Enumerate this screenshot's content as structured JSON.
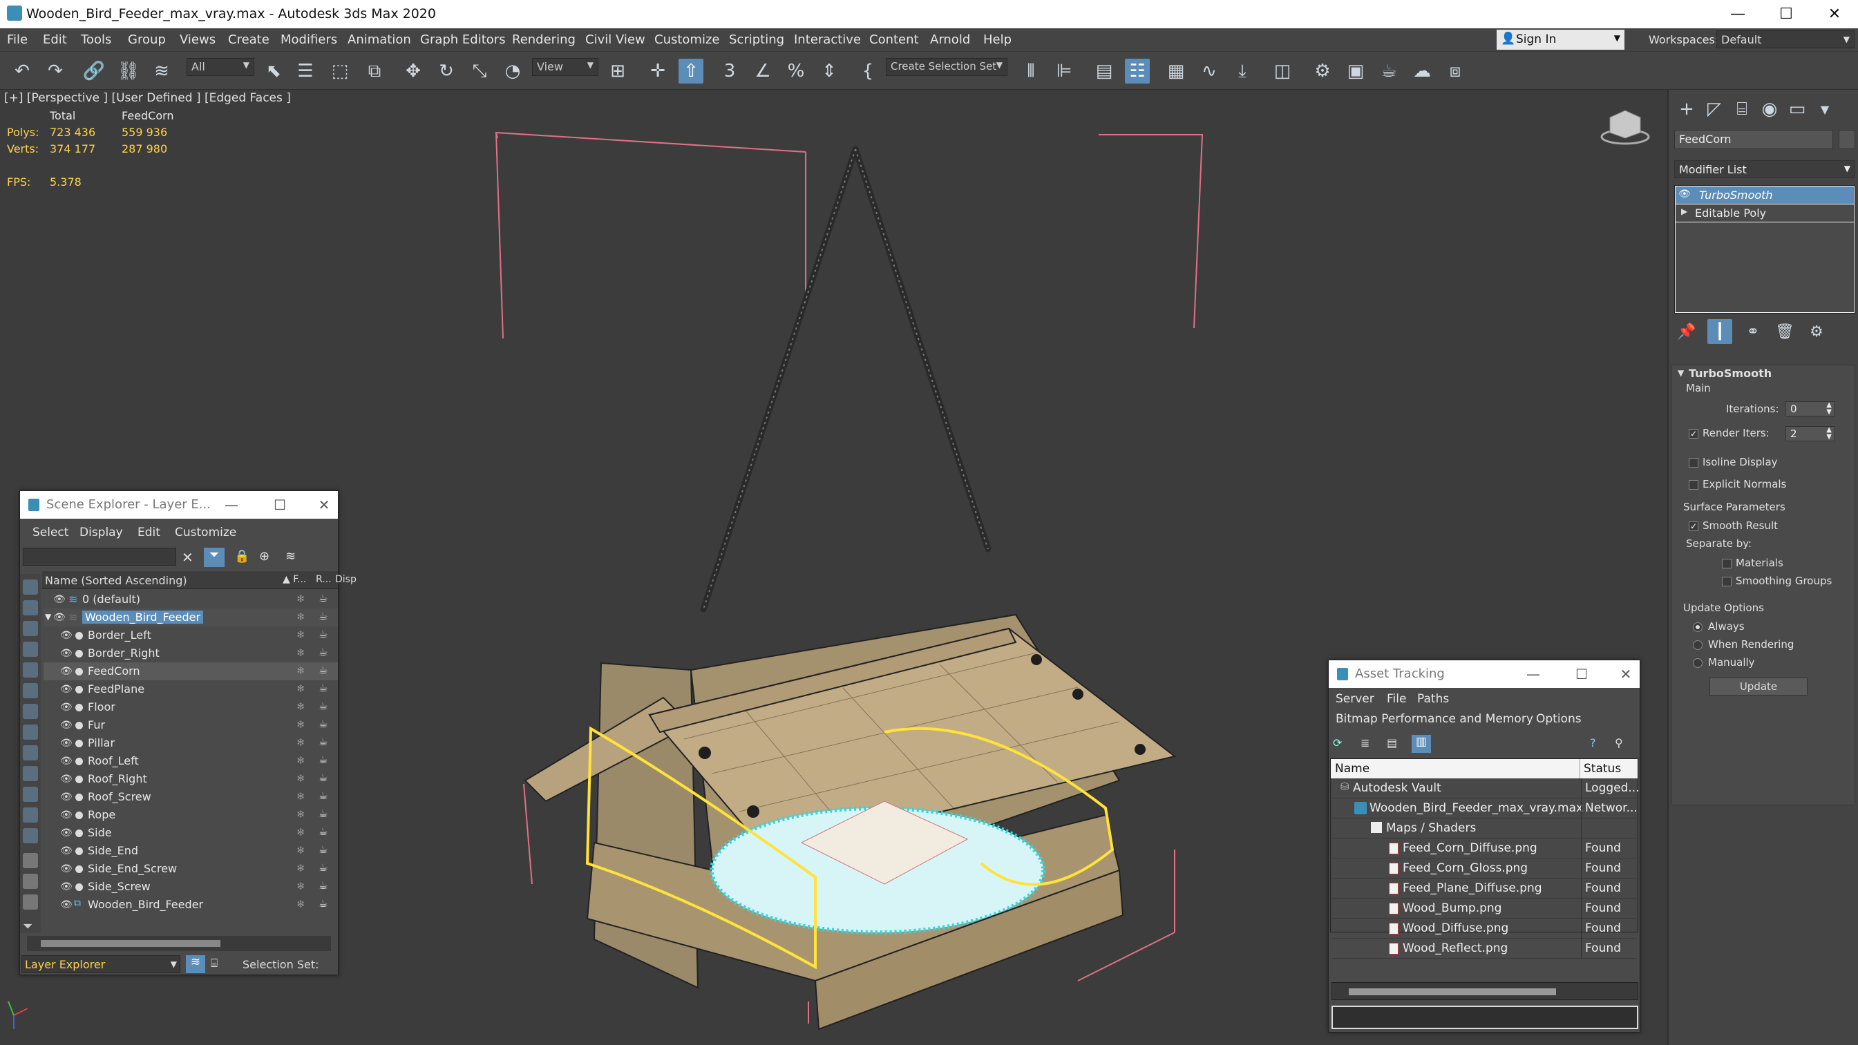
{
  "window": {
    "title": "Wooden_Bird_Feeder_max_vray.max - Autodesk 3ds Max 2020",
    "minimize": "—",
    "maximize": "☐",
    "close": "✕"
  },
  "menu": [
    "File",
    "Edit",
    "Tools",
    "Group",
    "Views",
    "Create",
    "Modifiers",
    "Animation",
    "Graph Editors",
    "Rendering",
    "Civil View",
    "Customize",
    "Scripting",
    "Interactive",
    "Content",
    "Arnold",
    "Help"
  ],
  "account": {
    "sign_in": "Sign In",
    "workspaces_label": "Workspaces:",
    "workspace_value": "Default"
  },
  "toolbar": {
    "selection_filter": "All",
    "ref_coord": "View",
    "named_selection": "Create Selection Set"
  },
  "viewport": {
    "label": "[+] [Perspective ] [User Defined ] [Edged Faces ]",
    "stats": {
      "col_total": "Total",
      "col_obj": "FeedCorn",
      "polys_label": "Polys:",
      "polys_total": "723 436",
      "polys_obj": "559 936",
      "verts_label": "Verts:",
      "verts_total": "374 177",
      "verts_obj": "287 980",
      "fps_label": "FPS:",
      "fps_value": "5.378"
    }
  },
  "command_panel": {
    "object_name": "FeedCorn",
    "modifier_list": "Modifier List",
    "stack": [
      "TurboSmooth",
      "Editable Poly"
    ],
    "rollout_title": "TurboSmooth",
    "main": "Main",
    "iterations_label": "Iterations:",
    "iterations_value": "0",
    "render_iters_label": "Render Iters:",
    "render_iters_value": "2",
    "isoline": "Isoline Display",
    "explicit_normals": "Explicit Normals",
    "surface_params": "Surface Parameters",
    "smooth_result": "Smooth Result",
    "separate_by": "Separate by:",
    "materials": "Materials",
    "smoothing_groups": "Smoothing Groups",
    "update_options": "Update Options",
    "always": "Always",
    "when_rendering": "When Rendering",
    "manually": "Manually",
    "update_button": "Update"
  },
  "scene_explorer": {
    "title": "Scene Explorer - Layer E...",
    "menu": [
      "Select",
      "Display",
      "Edit",
      "Customize"
    ],
    "col_name": "Name (Sorted Ascending)",
    "col_f": "▲ F...",
    "col_r": "R...",
    "col_d": "Disp",
    "layers": [
      {
        "name": "0 (default)",
        "level": 0
      },
      {
        "name": "Wooden_Bird_Feeder",
        "level": 0
      }
    ],
    "objects": [
      "Border_Left",
      "Border_Right",
      "FeedCorn",
      "FeedPlane",
      "Floor",
      "Fur",
      "Pillar",
      "Roof_Left",
      "Roof_Right",
      "Roof_Screw",
      "Rope",
      "Side",
      "Side_End",
      "Side_End_Screw",
      "Side_Screw",
      "Wooden_Bird_Feeder"
    ],
    "footer_mode": "Layer Explorer",
    "footer_selset": "Selection Set:"
  },
  "asset_tracking": {
    "title": "Asset Tracking",
    "menu1": [
      "Server",
      "File",
      "Paths"
    ],
    "menu2": [
      "Bitmap Performance and Memory",
      "Options"
    ],
    "col_name": "Name",
    "col_status": "Status",
    "rows": [
      {
        "name": "Autodesk Vault",
        "status": "Logged...",
        "indent": 1
      },
      {
        "name": "Wooden_Bird_Feeder_max_vray.max",
        "status": "Networ...",
        "indent": 2
      },
      {
        "name": "Maps / Shaders",
        "status": "",
        "indent": 3
      },
      {
        "name": "Feed_Corn_Diffuse.png",
        "status": "Found",
        "indent": 4
      },
      {
        "name": "Feed_Corn_Gloss.png",
        "status": "Found",
        "indent": 4
      },
      {
        "name": "Feed_Plane_Diffuse.png",
        "status": "Found",
        "indent": 4
      },
      {
        "name": "Wood_Bump.png",
        "status": "Found",
        "indent": 4
      },
      {
        "name": "Wood_Diffuse.png",
        "status": "Found",
        "indent": 4
      },
      {
        "name": "Wood_Reflect.png",
        "status": "Found",
        "indent": 4
      }
    ]
  },
  "colors": {
    "accent": "#5b8db8",
    "selection_yellow": "#ffe23a",
    "stats_yellow": "#ffd24a",
    "bbox_pink": "#e0708a"
  }
}
